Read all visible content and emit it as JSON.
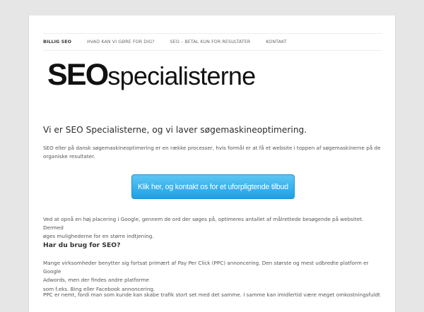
{
  "nav": {
    "items": [
      {
        "label": "BILLIG SEO"
      },
      {
        "label": "HVAD KAN VI GØRE FOR DIG?"
      },
      {
        "label": "SEO – BETAL KUN FOR RESULTATER"
      },
      {
        "label": "KONTAKT"
      }
    ]
  },
  "logo": {
    "bold_part": "SEO",
    "light_part": "specialisterne"
  },
  "content": {
    "title": "Vi er SEO Specialisterne, og vi laver søgemaskineoptimering.",
    "intro_line1": "SEO eller på dansk søgemaskineoptimering er en række processer, hvis formål er at få et website i toppen af søgemaskinerne på de",
    "intro_line2": "organiske resultater.",
    "cta_label": "Klik her, og kontakt os for et uforpligtende tilbud",
    "para2_line1": "Ved at opnå en høj placering i Google, gennem de ord der søges på, optimeres antallet af målrettede besøgende på websitet. Dermed",
    "para2_line2": "øges mulighederne for en større indtjening.",
    "subheading": "Har du brug for SEO?",
    "para3_line1": "Mange virksomheder benytter sig fortsat primært af Pay Per Click (PPC) annoncering. Den største og mest udbredte platform er Google",
    "para3_line2": "Adwords, men der findes andre platforme",
    "para3_line3": "som f.eks. Bing eller Facebook annoncering.",
    "para4_line1": "PPC er nemt, fordi man som kunde kan skabe trafik stort set med det samme. I samme kan imidlertid være meget omkostningsfuldt"
  }
}
